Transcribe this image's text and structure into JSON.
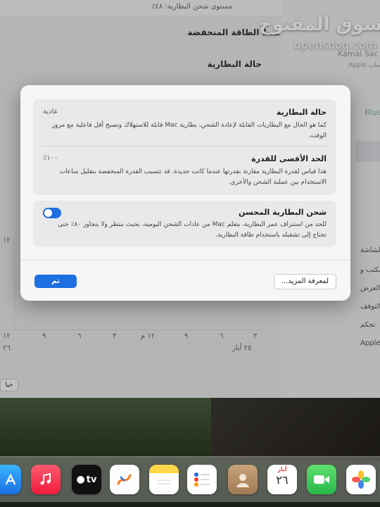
{
  "background": {
    "top_status": "مستوى شحن البطارية: ٤٨٪",
    "heading_low_power": "نمط الطاقة المنخفضة",
    "heading_battery_health": "حالة البطارية",
    "right_panel_name": "Kamal Sac",
    "right_panel_sub": "حساب Apple",
    "right_panel_blue": "Blue",
    "right_panel_items": [
      "الشاشة",
      "المكتب و",
      "العرض",
      "التوقف",
      "تحكم",
      "Siri و Apple"
    ],
    "left_value": "١٢",
    "x_ticks": [
      "٣",
      "٦",
      "٩",
      "١٢ م",
      "٣",
      "٦",
      "٩",
      "١٢"
    ],
    "date_label": "٢٥ أيار",
    "left_date": "٢٦",
    "left_button": "خيا"
  },
  "watermark": {
    "logo_text": "السوق المفتوح",
    "url": "opensooq.com"
  },
  "dialog": {
    "battery_condition": {
      "title": "حالة البطارية",
      "value": "عادية",
      "description": "كما هو الحال مع البطاريات القابلة لإعادة الشحن، بطارية Mac قابلة للاستهلاك وتصبح أقل فاعلية مع مرور الوقت."
    },
    "max_capacity": {
      "title": "الحد الأقصى للقدرة",
      "value": "١٠٠٪",
      "description": "هذا قياس لقدرة البطارية مقارنة بقدرتها عندما كانت جديدة. قد تتسبب القدرة المنخفضة بتقليل ساعات الاستخدام بين عملية الشحن والأخرى."
    },
    "optimized_charging": {
      "title": "شحن البطارية المحسن",
      "enabled": true,
      "description": "للحد من استنزاف عمر البطارية، يتعلم Mac من عادات الشحن اليومية، بحيث ينتظر ولا يتجاوز ٨٠٪ حتى تحتاج إلى تشغيله باستخدام طاقة البطارية."
    },
    "learn_more_label": "لمعرفة المزيد...",
    "done_label": "تم"
  },
  "dock": {
    "calendar_month": "أيار",
    "calendar_day": "٢٦",
    "tv_label": "tv",
    "icons": [
      "app-store-icon",
      "music-icon",
      "apple-tv-icon",
      "freeform-icon",
      "notes-icon",
      "reminders-icon",
      "contacts-icon",
      "calendar-icon",
      "facetime-icon",
      "photos-icon"
    ]
  },
  "colors": {
    "accent": "#1e6fe0",
    "dialog_bg": "#f6f6f7",
    "card_bg": "#e9e9eb"
  }
}
